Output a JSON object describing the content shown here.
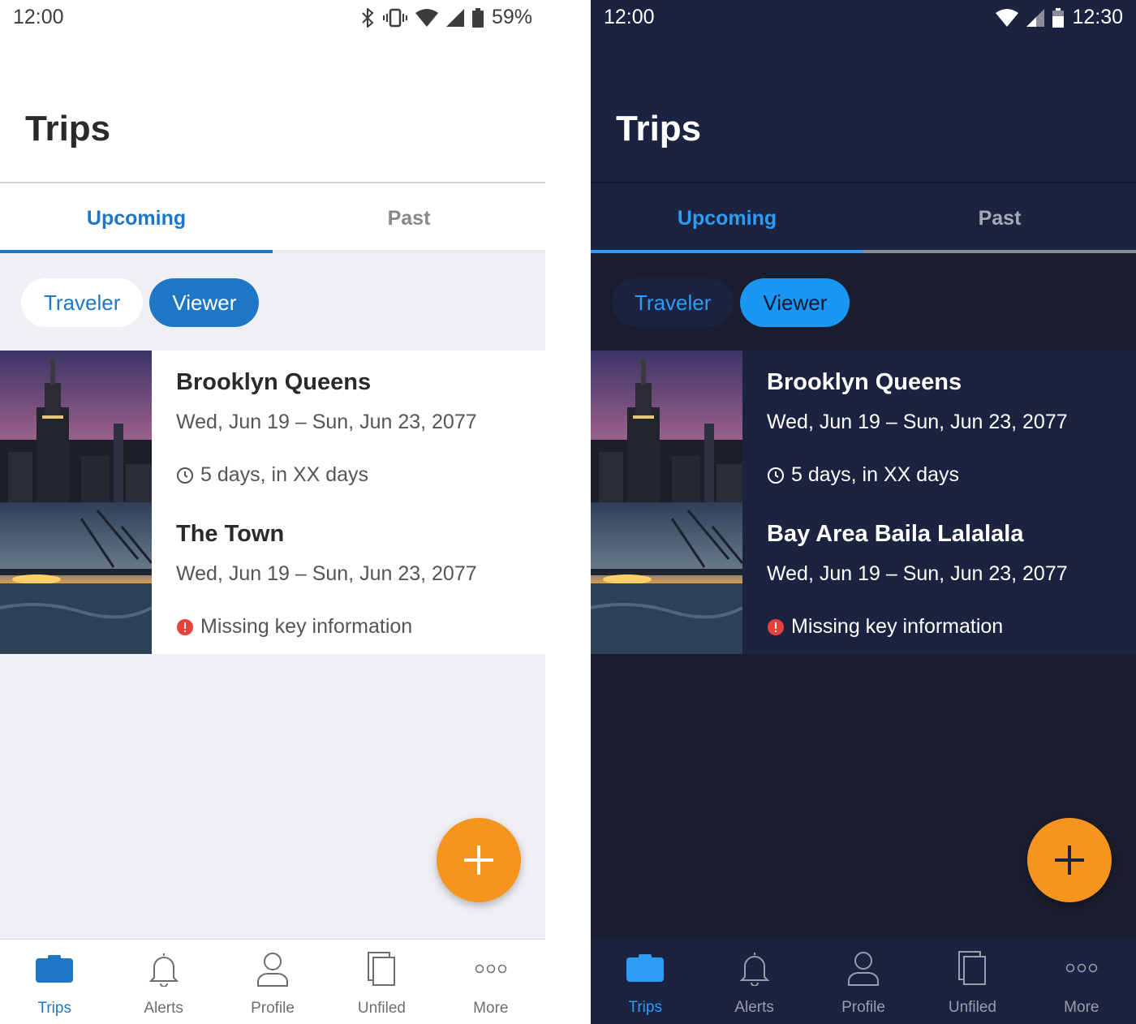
{
  "colors": {
    "accent_light": "#1e77c5",
    "accent_dark": "#2d9cf5",
    "fab": "#f6951e",
    "alert": "#e8413c",
    "dark_bg": "#191d2d",
    "dark_surface": "#1b2341"
  },
  "light": {
    "status": {
      "time": "12:00",
      "battery": "59%"
    },
    "title": "Trips",
    "tabs": [
      "Upcoming",
      "Past"
    ],
    "chips": [
      "Traveler",
      "Viewer"
    ],
    "trips": [
      {
        "name": "Brooklyn Queens",
        "dates": "Wed, Jun 19 – Sun, Jun 23, 2077",
        "meta": "5 days, in XX days",
        "meta_icon": "clock-icon",
        "image": "city-skyline-image"
      },
      {
        "name": "The Town",
        "dates": "Wed, Jun 19 – Sun, Jun 23, 2077",
        "meta": "Missing key information",
        "meta_icon": "alert-icon",
        "image": "harbor-sunset-image"
      }
    ],
    "nav": [
      "Trips",
      "Alerts",
      "Profile",
      "Unfiled",
      "More"
    ]
  },
  "dark": {
    "status": {
      "time": "12:00",
      "clock": "12:30"
    },
    "title": "Trips",
    "tabs": [
      "Upcoming",
      "Past"
    ],
    "chips": [
      "Traveler",
      "Viewer"
    ],
    "trips": [
      {
        "name": "Brooklyn Queens",
        "dates": "Wed, Jun 19 – Sun, Jun 23, 2077",
        "meta": "5 days, in XX days",
        "meta_icon": "clock-icon",
        "image": "city-skyline-image"
      },
      {
        "name": "Bay Area Baila Lalalala",
        "dates": "Wed, Jun 19 – Sun, Jun 23, 2077",
        "meta": "Missing key information",
        "meta_icon": "alert-icon",
        "image": "harbor-sunset-image"
      }
    ],
    "nav": [
      "Trips",
      "Alerts",
      "Profile",
      "Unfiled",
      "More"
    ]
  }
}
